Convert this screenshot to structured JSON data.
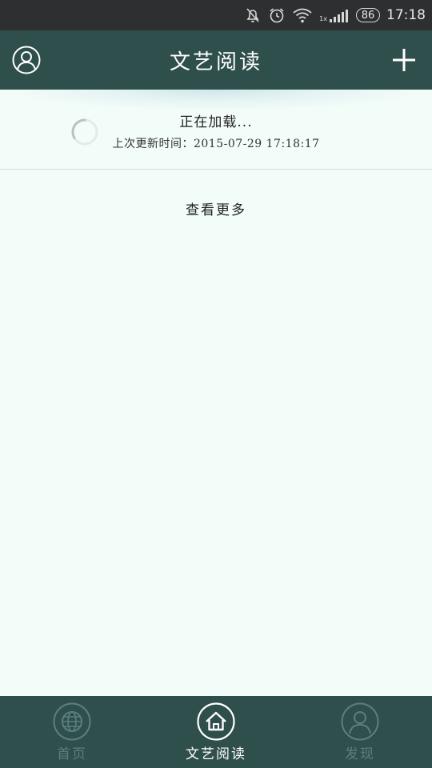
{
  "status_bar": {
    "network_label": "1x",
    "battery": "86",
    "time": "17:18",
    "icons": [
      "mute-icon",
      "alarm-icon",
      "wifi-icon",
      "signal-icon",
      "battery-icon"
    ]
  },
  "header": {
    "title": "文艺阅读",
    "left_icon": "user-avatar-icon",
    "right_icon": "plus-icon",
    "background": "#2f4f4d"
  },
  "refresh": {
    "status": "正在加载...",
    "last_update_label": "上次更新时间：",
    "last_update_time": "2015-07-29 17:18:17"
  },
  "list": {
    "view_more": "查看更多"
  },
  "bottom_nav": {
    "items": [
      {
        "label": "首页",
        "icon": "globe-icon",
        "active": false
      },
      {
        "label": "文艺阅读",
        "icon": "home-icon",
        "active": true
      },
      {
        "label": "发现",
        "icon": "person-icon",
        "active": false
      }
    ],
    "active_color": "#ffffff",
    "inactive_color": "#5c7f7c"
  },
  "colors": {
    "page_background": "#f2fcf8",
    "status_bar": "#2e2f31"
  }
}
